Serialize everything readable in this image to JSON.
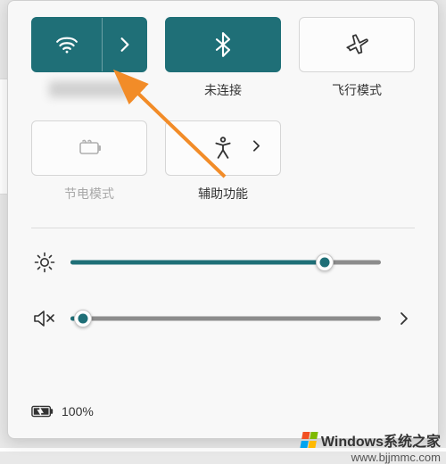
{
  "colors": {
    "accent": "#1f6f77",
    "winRed": "#f25022",
    "winGreen": "#7fba00",
    "winBlue": "#00a4ef",
    "winYellow": "#ffb900"
  },
  "tiles": {
    "wifi": {
      "label": ""
    },
    "bluetooth": {
      "label": "未连接"
    },
    "airplane": {
      "label": "飞行模式"
    },
    "battery_saver": {
      "label": "节电模式"
    },
    "accessibility": {
      "label": "辅助功能"
    }
  },
  "sliders": {
    "brightness": {
      "pct": 82
    },
    "volume": {
      "pct": 4
    }
  },
  "status": {
    "battery_pct": "100%"
  },
  "watermark": {
    "line1": "Windows系统之家",
    "line2": "www.bjjmmc.com"
  }
}
